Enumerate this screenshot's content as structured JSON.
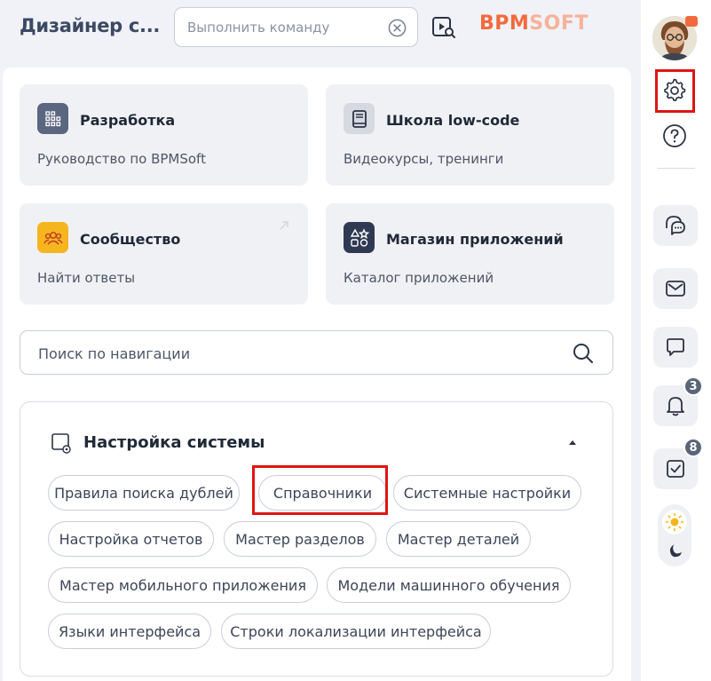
{
  "header": {
    "app_title": "Дизайнер с...",
    "command_placeholder": "Выполнить команду",
    "logo_primary": "BPM",
    "logo_secondary": "SOFT"
  },
  "cards": [
    {
      "title": "Разработка",
      "subtitle": "Руководство по BPMSoft",
      "icon": "grid-code-icon"
    },
    {
      "title": "Школа low-code",
      "subtitle": "Видеокурсы, тренинги",
      "icon": "book-icon"
    },
    {
      "title": "Сообщество",
      "subtitle": "Найти ответы",
      "icon": "people-icon"
    },
    {
      "title": "Магазин приложений",
      "subtitle": "Каталог приложений",
      "icon": "shapes-icon"
    }
  ],
  "nav_search": {
    "placeholder": "Поиск по навигации"
  },
  "section": {
    "title": "Настройка системы",
    "chips": [
      "Правила поиска дублей",
      "Справочники",
      "Системные настройки",
      "Настройка отчетов",
      "Мастер разделов",
      "Мастер деталей",
      "Мастер мобильного приложения",
      "Модели машинного обучения",
      "Языки интерфейса",
      "Строки локализации интерфейса"
    ]
  },
  "rail": {
    "notifications_count": "3",
    "tasks_count": "8"
  },
  "colors": {
    "brand": "#f26a3c",
    "highlight": "#e01515",
    "accent_dark": "#3c4964"
  }
}
